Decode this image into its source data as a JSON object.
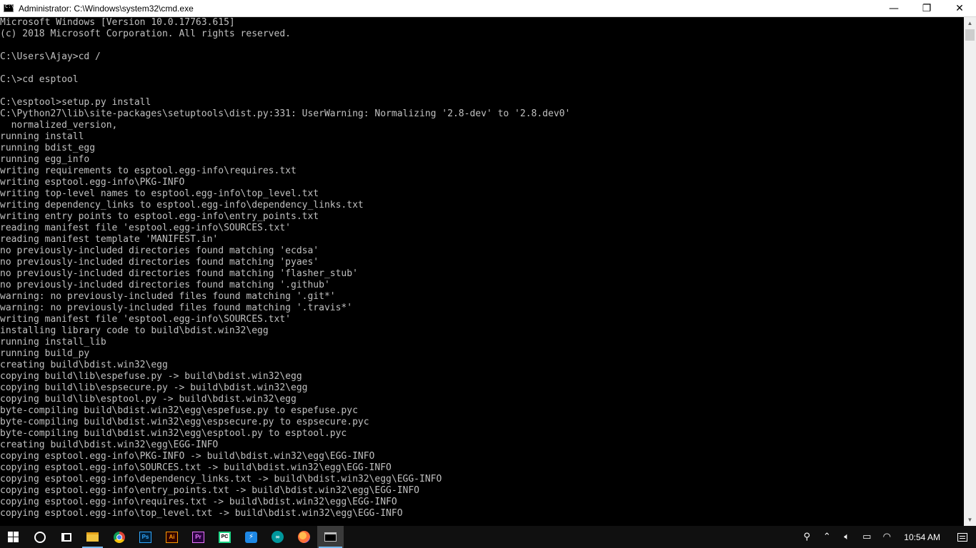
{
  "window": {
    "title": "Administrator: C:\\Windows\\system32\\cmd.exe",
    "minimize_glyph": "—",
    "restore_glyph": "❐",
    "close_glyph": "✕"
  },
  "console": {
    "lines": [
      "Microsoft Windows [Version 10.0.17763.615]",
      "(c) 2018 Microsoft Corporation. All rights reserved.",
      "",
      "C:\\Users\\Ajay>cd /",
      "",
      "C:\\>cd esptool",
      "",
      "C:\\esptool>setup.py install",
      "C:\\Python27\\lib\\site-packages\\setuptools\\dist.py:331: UserWarning: Normalizing '2.8-dev' to '2.8.dev0'",
      "  normalized_version,",
      "running install",
      "running bdist_egg",
      "running egg_info",
      "writing requirements to esptool.egg-info\\requires.txt",
      "writing esptool.egg-info\\PKG-INFO",
      "writing top-level names to esptool.egg-info\\top_level.txt",
      "writing dependency_links to esptool.egg-info\\dependency_links.txt",
      "writing entry points to esptool.egg-info\\entry_points.txt",
      "reading manifest file 'esptool.egg-info\\SOURCES.txt'",
      "reading manifest template 'MANIFEST.in'",
      "no previously-included directories found matching 'ecdsa'",
      "no previously-included directories found matching 'pyaes'",
      "no previously-included directories found matching 'flasher_stub'",
      "no previously-included directories found matching '.github'",
      "warning: no previously-included files found matching '.git*'",
      "warning: no previously-included files found matching '.travis*'",
      "writing manifest file 'esptool.egg-info\\SOURCES.txt'",
      "installing library code to build\\bdist.win32\\egg",
      "running install_lib",
      "running build_py",
      "creating build\\bdist.win32\\egg",
      "copying build\\lib\\espefuse.py -> build\\bdist.win32\\egg",
      "copying build\\lib\\espsecure.py -> build\\bdist.win32\\egg",
      "copying build\\lib\\esptool.py -> build\\bdist.win32\\egg",
      "byte-compiling build\\bdist.win32\\egg\\espefuse.py to espefuse.pyc",
      "byte-compiling build\\bdist.win32\\egg\\espsecure.py to espsecure.pyc",
      "byte-compiling build\\bdist.win32\\egg\\esptool.py to esptool.pyc",
      "creating build\\bdist.win32\\egg\\EGG-INFO",
      "copying esptool.egg-info\\PKG-INFO -> build\\bdist.win32\\egg\\EGG-INFO",
      "copying esptool.egg-info\\SOURCES.txt -> build\\bdist.win32\\egg\\EGG-INFO",
      "copying esptool.egg-info\\dependency_links.txt -> build\\bdist.win32\\egg\\EGG-INFO",
      "copying esptool.egg-info\\entry_points.txt -> build\\bdist.win32\\egg\\EGG-INFO",
      "copying esptool.egg-info\\requires.txt -> build\\bdist.win32\\egg\\EGG-INFO",
      "copying esptool.egg-info\\top_level.txt -> build\\bdist.win32\\egg\\EGG-INFO"
    ]
  },
  "taskbar": {
    "apps": [
      {
        "name": "file-explorer",
        "icon": "folder-icon",
        "state": "running"
      },
      {
        "name": "chrome",
        "icon": "chrome-icon",
        "state": "none"
      },
      {
        "name": "photoshop",
        "icon": "photoshop-icon",
        "label": "Ps",
        "state": "none"
      },
      {
        "name": "illustrator",
        "icon": "illustrator-icon",
        "label": "Ai",
        "state": "none"
      },
      {
        "name": "premiere",
        "icon": "premiere-icon",
        "label": "Pr",
        "state": "none"
      },
      {
        "name": "pycharm",
        "icon": "pycharm-icon",
        "label": "PC",
        "state": "none"
      },
      {
        "name": "messenger",
        "icon": "messenger-icon",
        "state": "none"
      },
      {
        "name": "arduino",
        "icon": "arduino-icon",
        "state": "none"
      },
      {
        "name": "firefox",
        "icon": "firefox-icon",
        "state": "none"
      },
      {
        "name": "cmd",
        "icon": "cmd-icon",
        "state": "active"
      }
    ],
    "clock": "10:54 AM"
  },
  "colors": {
    "console_bg": "#000000",
    "console_fg": "#c0c0c0",
    "taskbar_bg": "#101010",
    "accent": "#76b9ed"
  }
}
